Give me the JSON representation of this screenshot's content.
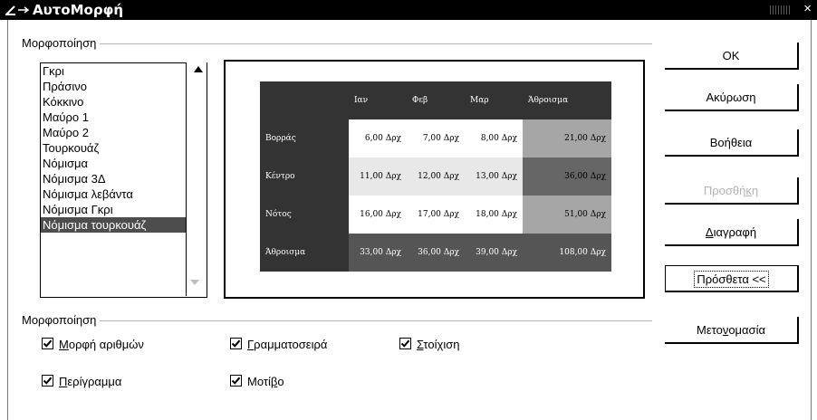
{
  "window": {
    "title": "ΑυτοΜορφή",
    "close_glyph": "×"
  },
  "format_group": {
    "label": "Μορφοποίηση"
  },
  "list": {
    "items": [
      "Γκρι",
      "Πράσινο",
      "Κόκκινο",
      "Μαύρο 1",
      "Μαύρο 2",
      "Τουρκουάζ",
      "Νόμισμα",
      "Νόμισμα 3Δ",
      "Νόμισμα λεβάντα",
      "Νόμισμα Γκρι",
      "Νόμισμα τουρκουάζ"
    ],
    "selected_index": 10
  },
  "preview": {
    "headers": [
      "",
      "Ιαν",
      "Φεβ",
      "Μαρ",
      "Άθροισμα"
    ],
    "rows": [
      {
        "label": "Βορράς",
        "values": [
          "6,00 Δρχ",
          "7,00 Δρχ",
          "8,00 Δρχ"
        ],
        "sum": "21,00 Δρχ"
      },
      {
        "label": "Κέντρο",
        "values": [
          "11,00 Δρχ",
          "12,00 Δρχ",
          "13,00 Δρχ"
        ],
        "sum": "36,00 Δρχ"
      },
      {
        "label": "Νότος",
        "values": [
          "16,00 Δρχ",
          "17,00 Δρχ",
          "18,00 Δρχ"
        ],
        "sum": "51,00 Δρχ"
      },
      {
        "label": "Άθροισμα",
        "values": [
          "33,00 Δρχ",
          "36,00 Δρχ",
          "39,00 Δρχ"
        ],
        "sum": "108,00 Δρχ"
      }
    ]
  },
  "buttons": {
    "ok": "OK",
    "cancel": "Ακύρωση",
    "help": "Βοήθεια",
    "add_pre": "Προσθή",
    "add_key": "κ",
    "add_post": "η",
    "delete_key": "Δ",
    "delete_post": "ιαγραφή",
    "more": "Πρόσθετα <<",
    "rename_pre": "Μετο",
    "rename_key": "ν",
    "rename_post": "ομασία"
  },
  "options_group": {
    "label": "Μορφοποίηση"
  },
  "options": {
    "number_format": {
      "key": "Μ",
      "rest": "ορφή αριθμών",
      "checked": true
    },
    "font": {
      "key": "Γ",
      "rest": "ραμματοσειρά",
      "checked": true
    },
    "alignment": {
      "key": "Σ",
      "rest": "τοίχιση",
      "checked": true
    },
    "border": {
      "key": "Π",
      "rest": "ερίγραμμα",
      "checked": true
    },
    "pattern": {
      "pre": "Μοτί",
      "key": "β",
      "rest": "ο",
      "checked": true
    }
  }
}
